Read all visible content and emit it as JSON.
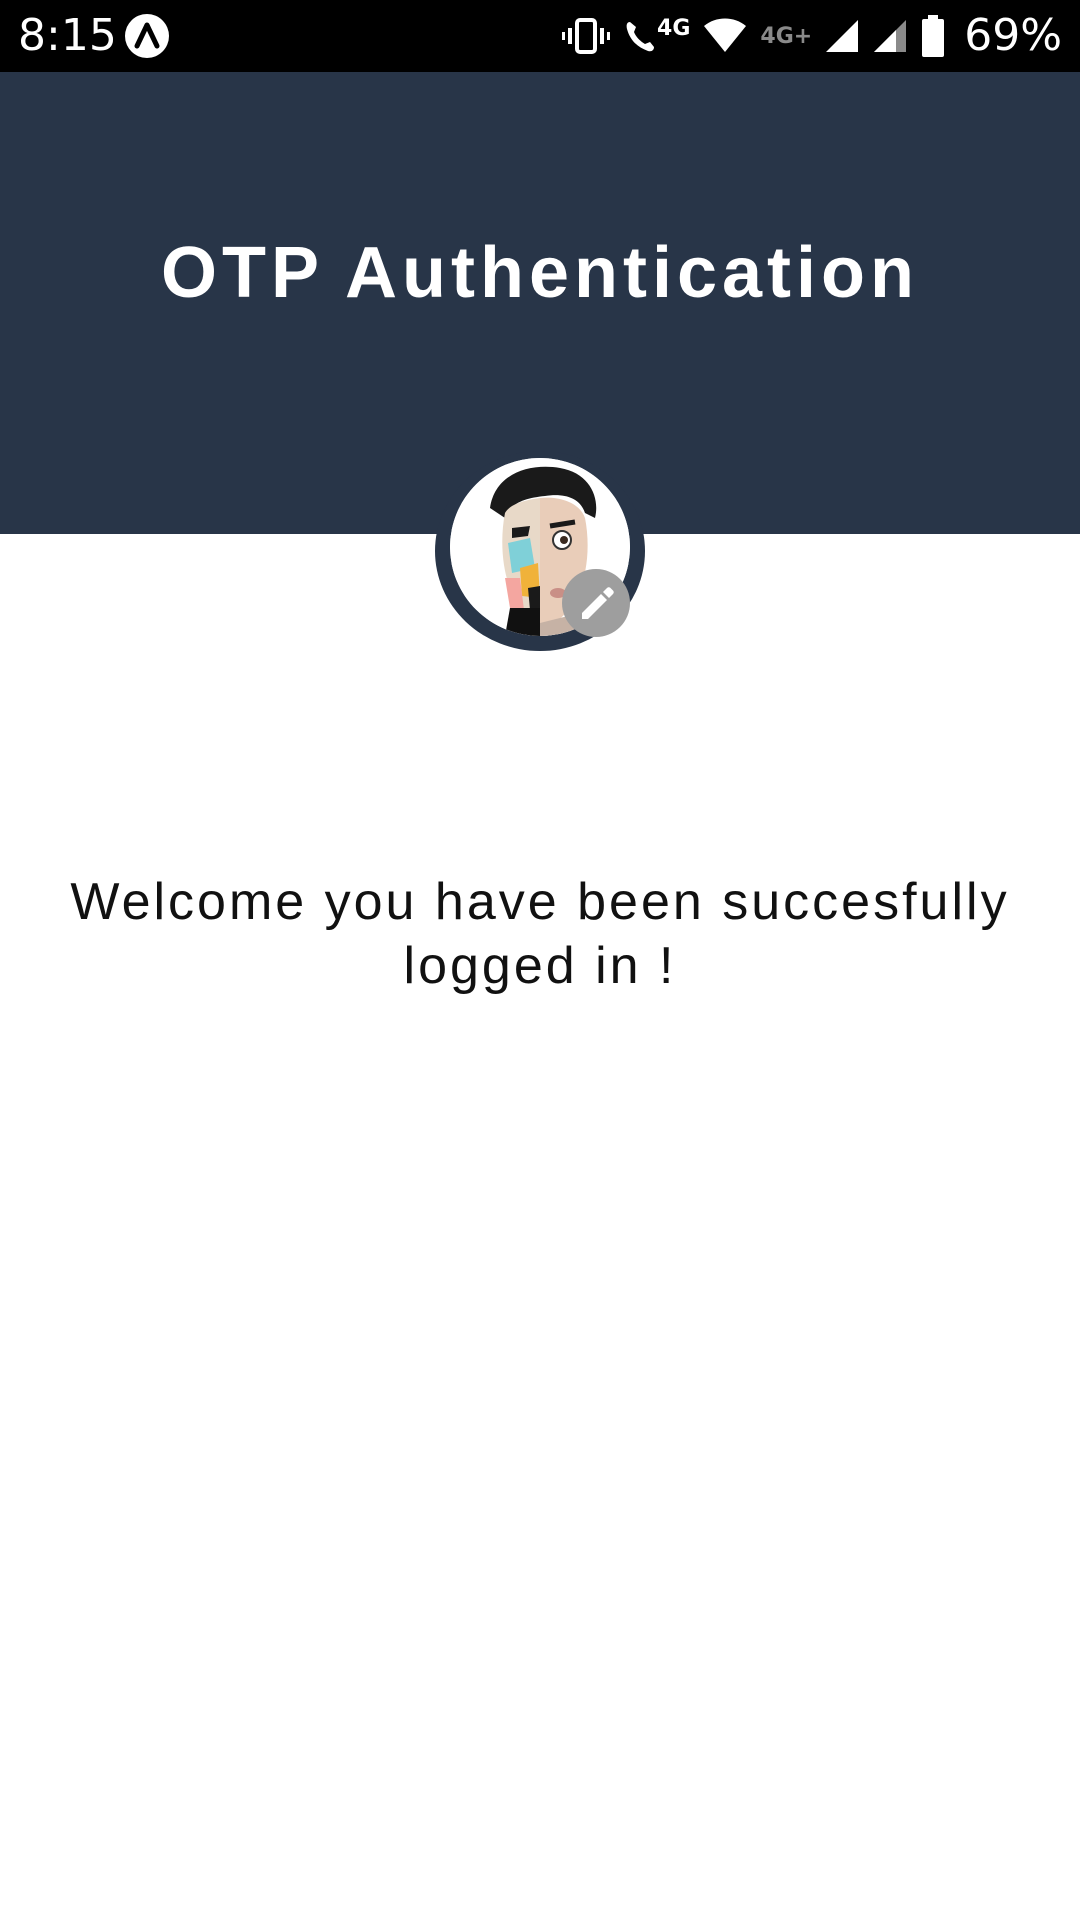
{
  "status_bar": {
    "time": "8:15",
    "app_icon": "arch-logo-icon",
    "icons": [
      "vibrate-icon",
      "volte-call-icon",
      "wifi-icon",
      "signal-icon",
      "signal-icon",
      "battery-icon"
    ],
    "call_network_label": "4G",
    "data_network_label": "4G+",
    "battery_percent": "69%"
  },
  "header": {
    "title": "OTP Authentication",
    "background_color": "#283548"
  },
  "profile": {
    "avatar": "avatar",
    "edit_icon": "pencil-icon",
    "edit_badge_color": "#9e9e9e"
  },
  "main": {
    "welcome_line1": "Welcome you have been succesfully",
    "welcome_line2": "logged in !"
  }
}
